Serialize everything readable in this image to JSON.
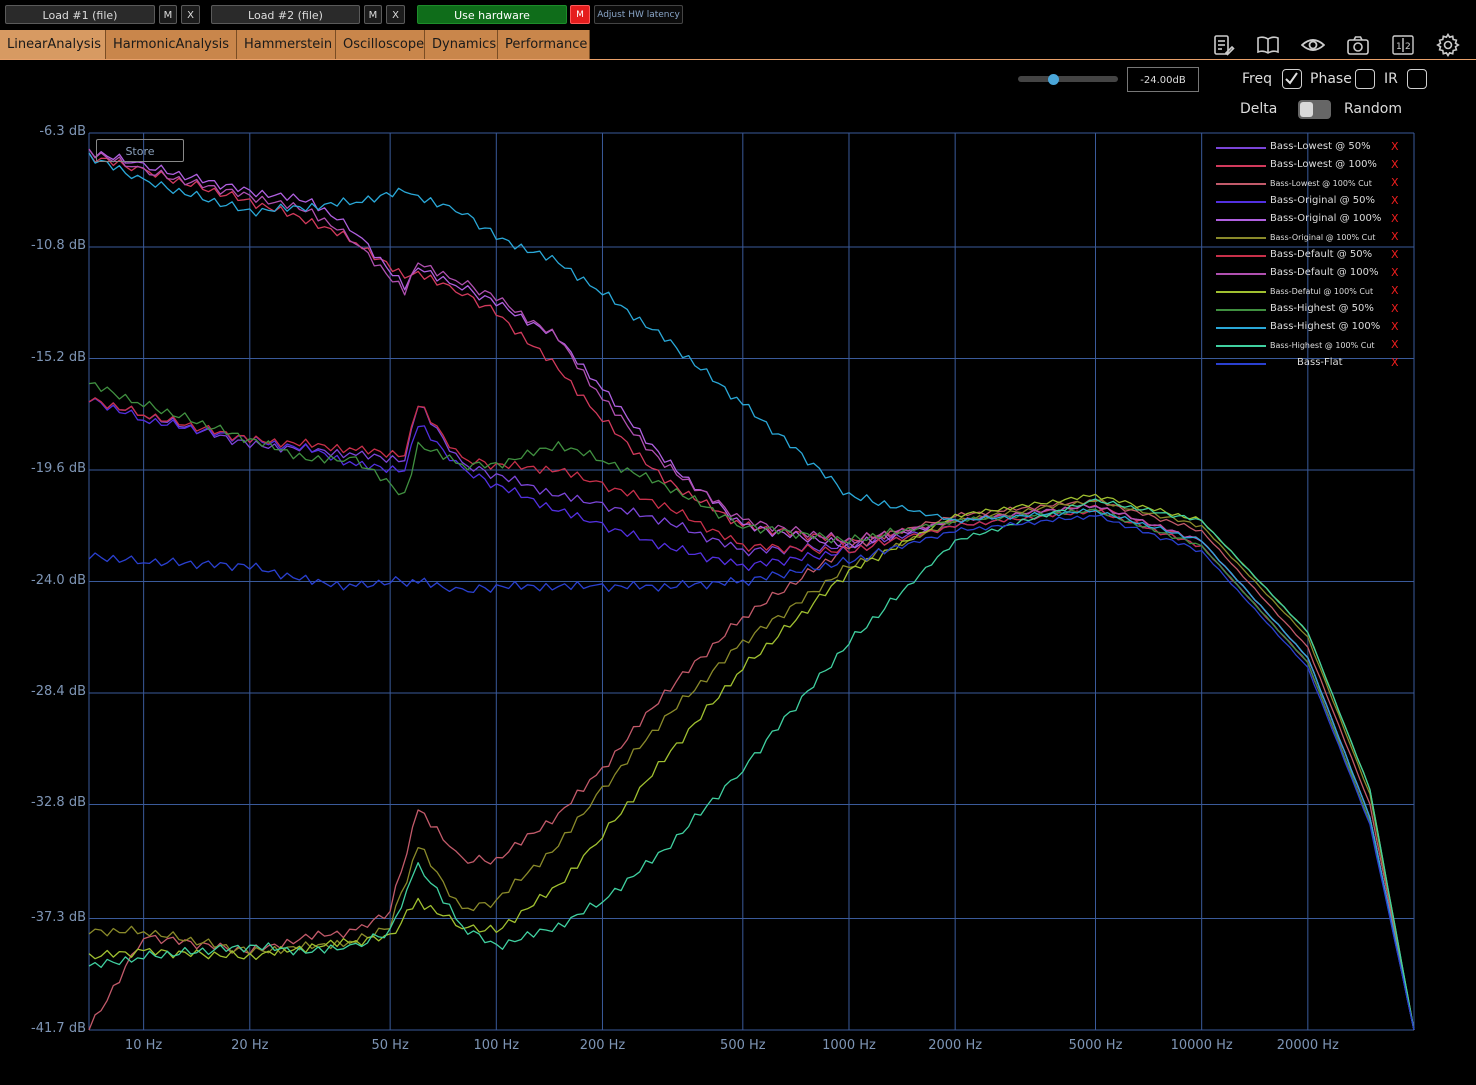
{
  "toolbar": {
    "load1": "Load #1 (file)",
    "load2": "Load #2 (file)",
    "m": "M",
    "x": "X",
    "use_hardware": "Use hardware",
    "hw_m": "M",
    "adjust": "Adjust HW latency"
  },
  "tabs": [
    "LinearAnalysis",
    "HarmonicAnalysis",
    "Hammerstein",
    "Oscilloscope",
    "Dynamics",
    "Performance"
  ],
  "icons": [
    "notes-icon",
    "book-icon",
    "eye-icon",
    "camera-icon",
    "one-half-icon",
    "gear-icon"
  ],
  "controls": {
    "db_value": "-24.00dB",
    "freq": "Freq",
    "phase": "Phase",
    "ir": "IR",
    "delta": "Delta",
    "random": "Random",
    "freq_checked": true,
    "phase_checked": false,
    "ir_checked": false,
    "slider_level": 0.35
  },
  "store": "Store",
  "legend": [
    {
      "name": "Bass-Lowest @ 50%",
      "color": "#7b45d8",
      "small": false
    },
    {
      "name": "Bass-Lowest @ 100%",
      "color": "#d23a5c",
      "small": false
    },
    {
      "name": "Bass-Lowest @ 100% Cut",
      "color": "#c25a6a",
      "small": true
    },
    {
      "name": "Bass-Original @ 50%",
      "color": "#5230e0",
      "small": false
    },
    {
      "name": "Bass-Original @ 100%",
      "color": "#b060e0",
      "small": false
    },
    {
      "name": "Bass-Original @ 100% Cut",
      "color": "#8a8a2a",
      "small": true
    },
    {
      "name": "Bass-Default @ 50%",
      "color": "#c8304a",
      "small": false
    },
    {
      "name": "Bass-Default @ 100%",
      "color": "#b050b0",
      "small": false
    },
    {
      "name": "Bass-Defatul @ 100% Cut",
      "color": "#a0c030",
      "small": true
    },
    {
      "name": "Bass-Highest @ 50%",
      "color": "#409040",
      "small": false
    },
    {
      "name": "Bass-Highest @ 100%",
      "color": "#2aa8d8",
      "small": false
    },
    {
      "name": "Bass-Highest @ 100% Cut",
      "color": "#40d0a0",
      "small": true
    },
    {
      "name": "Bass-Flat",
      "color": "#2a40d0",
      "small": false
    }
  ],
  "legend_remove": "X",
  "chart_data": {
    "type": "line",
    "x_scale": "log",
    "xlim": [
      7,
      40000
    ],
    "ylim": [
      -41.7,
      -6.3
    ],
    "yticks": [
      "-6.3 dB",
      "-10.8 dB",
      "-15.2 dB",
      "-19.6 dB",
      "-24.0 dB",
      "-28.4 dB",
      "-32.8 dB",
      "-37.3 dB",
      "-41.7 dB"
    ],
    "xticks": [
      "10 Hz",
      "20 Hz",
      "50 Hz",
      "100 Hz",
      "200 Hz",
      "500 Hz",
      "1000 Hz",
      "2000 Hz",
      "5000 Hz",
      "10000 Hz",
      "20000 Hz"
    ],
    "grid": true,
    "series": [
      {
        "name": "Bass-Lowest @ 50%",
        "color": "#7b45d8",
        "x": [
          7,
          10,
          20,
          30,
          40,
          55,
          60,
          80,
          100,
          150,
          200,
          300,
          500,
          1000,
          2000,
          5000,
          10000,
          20000,
          30000,
          40000
        ],
        "y": [
          -16.8,
          -17.4,
          -18.6,
          -18.8,
          -19.0,
          -19.2,
          -17.0,
          -19.4,
          -19.8,
          -20.6,
          -21.0,
          -21.6,
          -22.8,
          -22.6,
          -21.8,
          -21.2,
          -22.6,
          -27.2,
          -33.5,
          -41.7
        ]
      },
      {
        "name": "Bass-Lowest @ 100%",
        "color": "#d23a5c",
        "x": [
          7,
          10,
          20,
          30,
          40,
          55,
          60,
          80,
          100,
          150,
          200,
          300,
          500,
          1000,
          2000,
          5000,
          10000,
          20000,
          30000,
          40000
        ],
        "y": [
          -7.2,
          -7.8,
          -9.0,
          -9.8,
          -10.6,
          -12.0,
          -11.8,
          -12.6,
          -13.4,
          -15.6,
          -17.6,
          -20.0,
          -21.8,
          -22.4,
          -21.6,
          -21.0,
          -22.4,
          -27.0,
          -33.3,
          -41.7
        ]
      },
      {
        "name": "Bass-Lowest @ 100% Cut",
        "color": "#c25a6a",
        "x": [
          7,
          10,
          20,
          30,
          40,
          50,
          60,
          80,
          100,
          150,
          200,
          300,
          500,
          1000,
          2000,
          5000,
          10000,
          20000,
          30000,
          40000
        ],
        "y": [
          -41.7,
          -38.0,
          -38.6,
          -38.0,
          -37.8,
          -37.0,
          -33.0,
          -35.0,
          -35.0,
          -33.2,
          -31.4,
          -28.4,
          -25.4,
          -22.6,
          -21.4,
          -20.8,
          -22.0,
          -26.6,
          -32.8,
          -41.7
        ]
      },
      {
        "name": "Bass-Original @ 50%",
        "color": "#5230e0",
        "x": [
          7,
          10,
          20,
          30,
          40,
          55,
          60,
          80,
          100,
          150,
          200,
          300,
          500,
          1000,
          2000,
          5000,
          10000,
          20000,
          30000,
          40000
        ],
        "y": [
          -16.8,
          -17.6,
          -18.4,
          -18.8,
          -19.4,
          -19.6,
          -17.8,
          -19.6,
          -20.2,
          -21.2,
          -21.8,
          -22.6,
          -23.4,
          -22.8,
          -21.8,
          -21.2,
          -22.6,
          -27.2,
          -33.5,
          -41.7
        ]
      },
      {
        "name": "Bass-Original @ 100%",
        "color": "#b060e0",
        "x": [
          7,
          10,
          20,
          30,
          40,
          55,
          60,
          80,
          100,
          150,
          200,
          300,
          500,
          1000,
          2000,
          5000,
          10000,
          20000,
          30000,
          40000
        ],
        "y": [
          -7.0,
          -7.6,
          -8.6,
          -9.0,
          -10.2,
          -12.4,
          -11.6,
          -12.4,
          -13.0,
          -14.4,
          -16.4,
          -19.2,
          -21.8,
          -22.6,
          -21.6,
          -21.0,
          -22.4,
          -27.0,
          -33.3,
          -41.7
        ]
      },
      {
        "name": "Bass-Original @ 100% Cut",
        "color": "#8a8a2a",
        "x": [
          7,
          10,
          20,
          30,
          40,
          50,
          60,
          80,
          100,
          150,
          200,
          300,
          500,
          1000,
          2000,
          5000,
          10000,
          20000,
          30000,
          40000
        ],
        "y": [
          -37.8,
          -37.8,
          -38.6,
          -38.4,
          -38.2,
          -37.6,
          -34.4,
          -37.0,
          -36.6,
          -34.4,
          -32.2,
          -29.4,
          -26.4,
          -23.4,
          -21.6,
          -20.8,
          -21.8,
          -26.2,
          -32.4,
          -41.7
        ]
      },
      {
        "name": "Bass-Default @ 50%",
        "color": "#c8304a",
        "x": [
          7,
          10,
          20,
          30,
          40,
          55,
          60,
          80,
          100,
          150,
          200,
          300,
          500,
          1000,
          2000,
          5000,
          10000,
          20000,
          30000,
          40000
        ],
        "y": [
          -16.8,
          -17.4,
          -18.4,
          -18.6,
          -18.8,
          -19.0,
          -17.0,
          -19.2,
          -19.4,
          -19.6,
          -20.2,
          -21.0,
          -22.6,
          -22.8,
          -21.8,
          -21.2,
          -22.6,
          -27.2,
          -33.5,
          -41.7
        ]
      },
      {
        "name": "Bass-Default @ 100%",
        "color": "#b050b0",
        "x": [
          7,
          10,
          20,
          30,
          40,
          55,
          60,
          80,
          100,
          150,
          200,
          300,
          500,
          1000,
          2000,
          5000,
          10000,
          20000,
          30000,
          40000
        ],
        "y": [
          -7.0,
          -7.8,
          -8.8,
          -9.4,
          -10.6,
          -12.6,
          -11.4,
          -12.2,
          -12.8,
          -14.4,
          -16.8,
          -19.4,
          -21.6,
          -22.4,
          -21.6,
          -21.0,
          -22.4,
          -27.0,
          -33.3,
          -41.7
        ]
      },
      {
        "name": "Bass-Defatul @ 100% Cut",
        "color": "#a0c030",
        "x": [
          7,
          10,
          20,
          30,
          40,
          50,
          60,
          80,
          100,
          150,
          200,
          300,
          500,
          1000,
          2000,
          5000,
          10000,
          20000,
          30000,
          40000
        ],
        "y": [
          -38.8,
          -38.6,
          -38.8,
          -38.4,
          -38.2,
          -38.0,
          -36.6,
          -37.6,
          -37.8,
          -36.0,
          -34.0,
          -31.0,
          -27.4,
          -23.6,
          -21.4,
          -20.6,
          -21.6,
          -26.0,
          -32.2,
          -41.7
        ]
      },
      {
        "name": "Bass-Highest @ 50%",
        "color": "#409040",
        "x": [
          7,
          10,
          20,
          30,
          40,
          55,
          60,
          80,
          100,
          150,
          200,
          300,
          500,
          1000,
          2000,
          5000,
          10000,
          20000,
          30000,
          40000
        ],
        "y": [
          -16.2,
          -17.0,
          -18.4,
          -19.2,
          -19.2,
          -20.6,
          -18.6,
          -19.4,
          -19.4,
          -18.6,
          -19.2,
          -20.2,
          -21.8,
          -22.4,
          -21.6,
          -21.2,
          -22.6,
          -27.2,
          -33.5,
          -41.7
        ]
      },
      {
        "name": "Bass-Highest @ 100%",
        "color": "#2aa8d8",
        "x": [
          7,
          10,
          20,
          30,
          40,
          55,
          60,
          80,
          100,
          150,
          200,
          300,
          500,
          1000,
          2000,
          5000,
          10000,
          20000,
          30000,
          40000
        ],
        "y": [
          -7.2,
          -8.2,
          -9.4,
          -9.2,
          -9.0,
          -8.6,
          -8.8,
          -9.4,
          -10.4,
          -11.4,
          -12.6,
          -14.4,
          -17.0,
          -20.6,
          -21.6,
          -21.2,
          -22.4,
          -27.0,
          -33.3,
          -41.7
        ]
      },
      {
        "name": "Bass-Highest @ 100% Cut",
        "color": "#40d0a0",
        "x": [
          7,
          10,
          20,
          30,
          40,
          50,
          60,
          80,
          100,
          150,
          200,
          300,
          500,
          1000,
          2000,
          5000,
          10000,
          20000,
          30000,
          40000
        ],
        "y": [
          -39.2,
          -38.8,
          -38.4,
          -38.6,
          -38.4,
          -37.8,
          -35.2,
          -37.6,
          -38.4,
          -37.6,
          -36.6,
          -34.6,
          -31.4,
          -26.4,
          -22.4,
          -20.8,
          -21.6,
          -26.0,
          -32.2,
          -41.7
        ]
      },
      {
        "name": "Bass-Flat",
        "color": "#2a40d0",
        "x": [
          7,
          10,
          20,
          30,
          40,
          50,
          60,
          80,
          100,
          150,
          200,
          300,
          500,
          1000,
          2000,
          5000,
          10000,
          20000,
          30000,
          40000
        ],
        "y": [
          -23.0,
          -23.2,
          -23.4,
          -24.0,
          -24.2,
          -24.0,
          -24.0,
          -24.4,
          -24.2,
          -24.2,
          -24.2,
          -24.2,
          -24.0,
          -23.2,
          -22.0,
          -21.4,
          -22.8,
          -27.4,
          -33.6,
          -41.7
        ]
      }
    ]
  }
}
